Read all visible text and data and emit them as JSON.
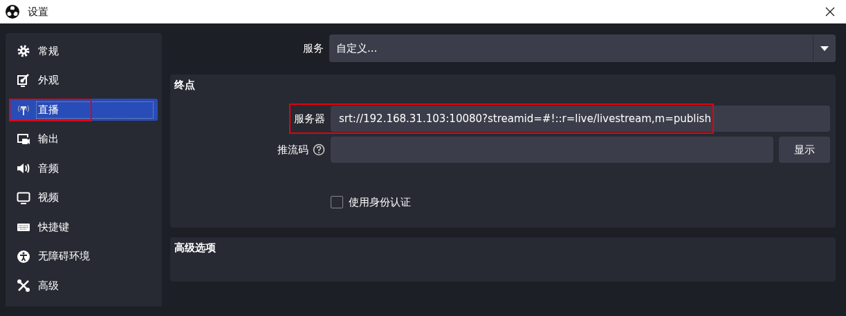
{
  "window": {
    "title": "设置"
  },
  "sidebar": {
    "items": [
      {
        "label": "常规",
        "selected": false,
        "highlighted": false
      },
      {
        "label": "外观",
        "selected": false,
        "highlighted": false
      },
      {
        "label": "直播",
        "selected": true,
        "highlighted": true
      },
      {
        "label": "输出",
        "selected": false,
        "highlighted": false
      },
      {
        "label": "音频",
        "selected": false,
        "highlighted": false
      },
      {
        "label": "视频",
        "selected": false,
        "highlighted": false
      },
      {
        "label": "快捷键",
        "selected": false,
        "highlighted": false
      },
      {
        "label": "无障碍环境",
        "selected": false,
        "highlighted": false
      },
      {
        "label": "高级",
        "selected": false,
        "highlighted": false
      }
    ]
  },
  "service": {
    "label": "服务",
    "value": "自定义..."
  },
  "endpoint": {
    "title": "终点",
    "server": {
      "label": "服务器",
      "value": "srt://192.168.31.103:10080?streamid=#!::r=live/livestream,m=publish",
      "highlighted": true
    },
    "stream_key": {
      "label": "推流码",
      "button": "显示"
    },
    "use_auth": {
      "label": "使用身份认证",
      "checked": false
    }
  },
  "advanced": {
    "title": "高级选项"
  }
}
